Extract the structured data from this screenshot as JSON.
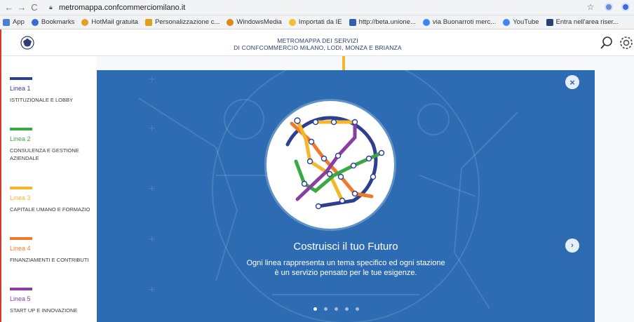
{
  "browser": {
    "url": "metromappa.confcommerciomilano.it",
    "bookmarks": [
      {
        "label": "App",
        "color": "#4a7fd8"
      },
      {
        "label": "Bookmarks",
        "color": "#3b6bd4"
      },
      {
        "label": "HotMail gratuita",
        "color": "#e0a020"
      },
      {
        "label": "Personalizzazione c...",
        "color": "#e0a020"
      },
      {
        "label": "WindowsMedia",
        "color": "#e08a10"
      },
      {
        "label": "Importati da IE",
        "color": "#f0c030"
      },
      {
        "label": "http://beta.unione...",
        "color": "#335fb0"
      },
      {
        "label": "via Buonarroti merc...",
        "color": "#4285f4"
      },
      {
        "label": "YouTube",
        "color": "#4285f4"
      },
      {
        "label": "Entra nell'area riser...",
        "color": "#2c3e74"
      }
    ]
  },
  "header": {
    "title_line1": "METROMAPPA DEI SERVIZI",
    "title_line2": "DI CONFCOMMERCIO MILANO, LODI, MONZA E BRIANZA"
  },
  "sidebar": {
    "lines": [
      {
        "name": "Linea 1",
        "desc": "ISTITUZIONALE E LOBBY",
        "color": "#2d3f8f"
      },
      {
        "name": "Linea 2",
        "desc": "CONSULENZA E GESTIONE",
        "desc2": "AZIENDALE",
        "color": "#3aa845"
      },
      {
        "name": "Linea 3",
        "desc": "CAPITALE UMANO E FORMAZIO",
        "color": "#f4b72a"
      },
      {
        "name": "Linea 4",
        "desc": "FINANZIAMENTI E CONTRIBUTI",
        "color": "#f07a2a"
      },
      {
        "name": "Linea 5",
        "desc": "START UP E INNOVAZIONE",
        "color": "#8a3fa0"
      }
    ]
  },
  "modal": {
    "title": "Costruisci il tuo Futuro",
    "text_line1": "Ogni linea rappresenta un tema specifico ed ogni stazione",
    "text_line2": "è un servizio pensato per le tue esigenze.",
    "close_icon": "×",
    "next_icon": "›",
    "slides": 5,
    "active_slide": 1
  },
  "colors": {
    "modal_bg": "#2d6cb2",
    "accent": "#d23a2a"
  }
}
